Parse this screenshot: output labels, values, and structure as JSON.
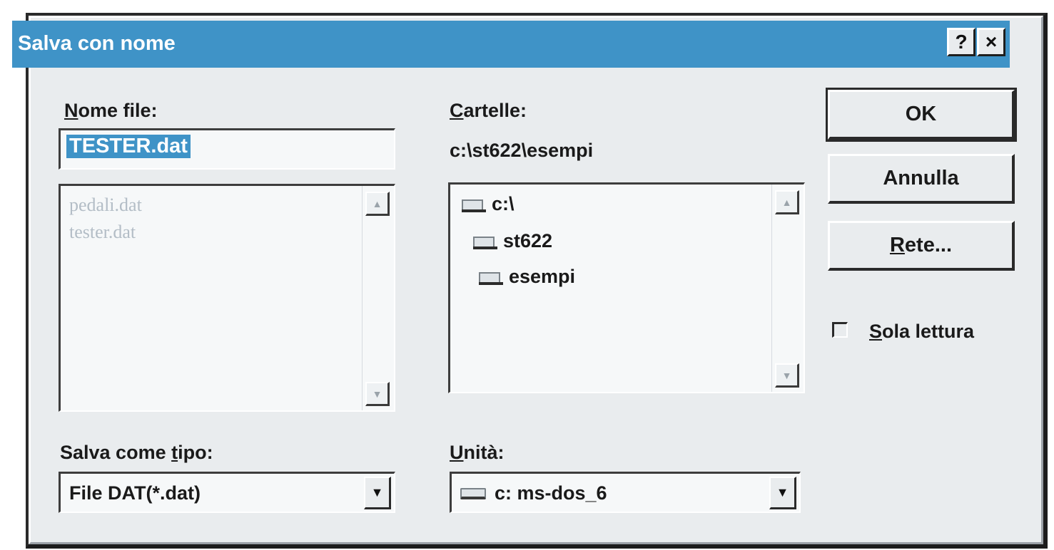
{
  "window": {
    "title": "Salva con nome",
    "help_button": "?",
    "close_button": "×"
  },
  "filename": {
    "label_accel": "N",
    "label_rest": "ome file:",
    "value": "TESTER.dat",
    "files": [
      "pedali.dat",
      "tester.dat"
    ]
  },
  "folders": {
    "label_accel": "C",
    "label_rest": "artelle:",
    "current_path": "c:\\st622\\esempi",
    "tree": [
      "c:\\",
      "st622",
      "esempi"
    ]
  },
  "buttons": {
    "ok": "OK",
    "cancel": "Annulla",
    "network_accel": "R",
    "network_rest": "ete..."
  },
  "read_only": {
    "label_accel": "S",
    "label_rest": "ola lettura",
    "checked": false
  },
  "save_type": {
    "label_pre": "Salva come ",
    "label_accel": "t",
    "label_rest": "ipo:",
    "value": "File DAT(*.dat)"
  },
  "drive": {
    "label_accel": "U",
    "label_rest": "nità:",
    "value": "c: ms-dos_6"
  },
  "icons": {
    "scroll_up": "▲",
    "scroll_down": "▼",
    "dropdown": "▼"
  }
}
